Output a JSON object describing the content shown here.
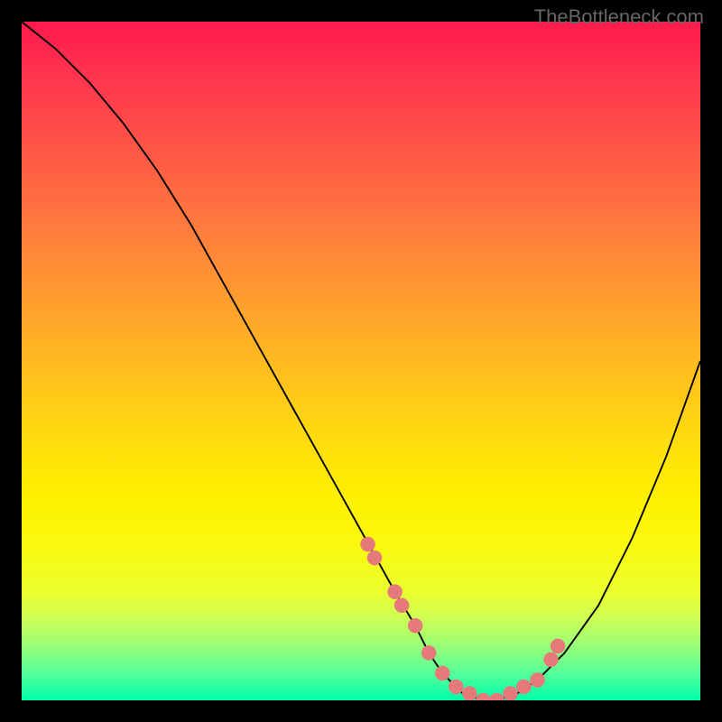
{
  "watermark": "TheBottleneck.com",
  "chart_data": {
    "type": "line",
    "title": "",
    "xlabel": "",
    "ylabel": "",
    "xlim": [
      0,
      100
    ],
    "ylim": [
      0,
      100
    ],
    "curve": {
      "name": "bottleneck-curve",
      "x": [
        0,
        5,
        10,
        15,
        20,
        25,
        30,
        35,
        40,
        45,
        50,
        55,
        58,
        60,
        62,
        65,
        68,
        70,
        73,
        76,
        80,
        85,
        90,
        95,
        100
      ],
      "y": [
        100,
        96,
        91,
        85,
        78,
        70,
        61,
        52,
        43,
        34,
        25,
        16,
        11,
        7,
        4,
        1,
        0,
        0,
        1,
        3,
        7,
        14,
        24,
        36,
        50
      ]
    },
    "markers": {
      "name": "highlight-points",
      "color": "#e67a7a",
      "x": [
        51,
        52,
        55,
        56,
        58,
        60,
        62,
        64,
        66,
        68,
        70,
        72,
        74,
        76,
        78,
        79
      ],
      "y": [
        23,
        21,
        16,
        14,
        11,
        7,
        4,
        2,
        1,
        0,
        0,
        1,
        2,
        3,
        6,
        8
      ]
    }
  }
}
